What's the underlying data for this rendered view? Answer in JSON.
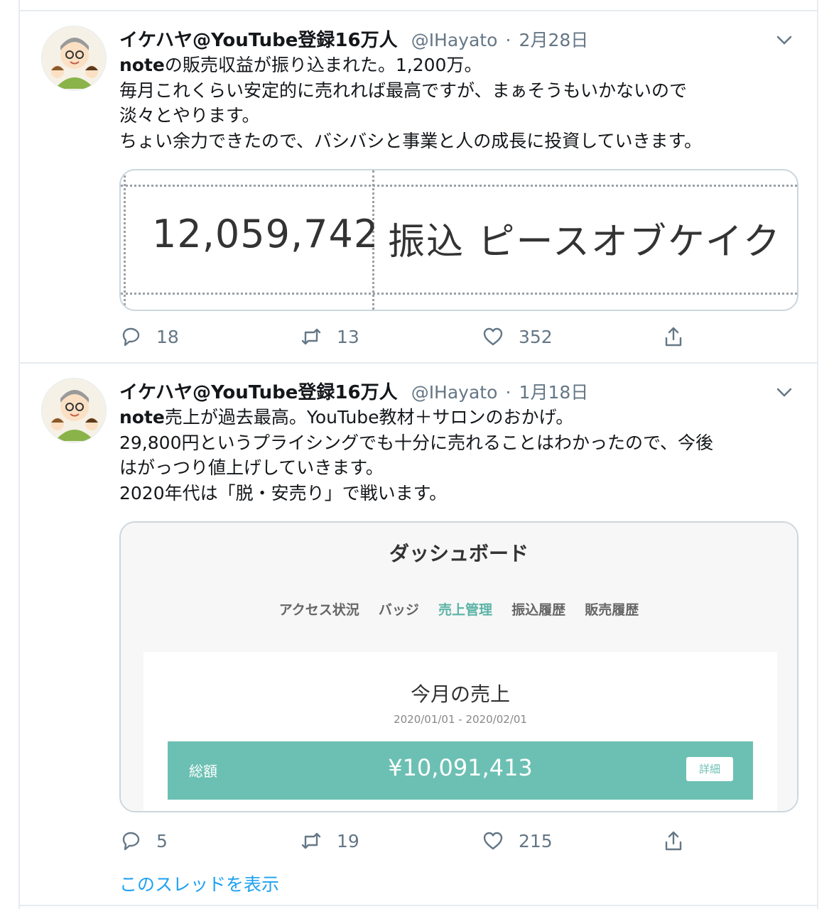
{
  "tweets": [
    {
      "author": "イケハヤ@YouTube登録16万人",
      "handle": "@IHayato",
      "separator": "·",
      "date": "2月28日",
      "lines": [
        {
          "bold": "note",
          "rest": "の販売収益が振り込まれた。1,200万。"
        },
        {
          "bold": "",
          "rest": "毎月これくらい安定的に売れれば最高ですが、まぁそうもいかないので"
        },
        {
          "bold": "",
          "rest": "淡々とやります。"
        },
        {
          "bold": "",
          "rest": "ちょい余力できたので、バシバシと事業と人の成長に投資していきます。"
        }
      ],
      "image": {
        "amount": "12,059,742",
        "text": "振込 ピースオブケイク"
      },
      "replies": "18",
      "retweets": "13",
      "likes": "352"
    },
    {
      "author": "イケハヤ@YouTube登録16万人",
      "handle": "@IHayato",
      "separator": "·",
      "date": "1月18日",
      "lines": [
        {
          "bold": "note",
          "rest": "売上が過去最高。YouTube教材＋サロンのおかげ。"
        },
        {
          "bold": "",
          "rest": "29,800円というプライシングでも十分に売れることはわかったので、今後"
        },
        {
          "bold": "",
          "rest": "はがっつり値上げしていきます。"
        },
        {
          "bold": "",
          "rest": "2020年代は「脱・安売り」で戦います。"
        }
      ],
      "image": {
        "title": "ダッシュボード",
        "tabs": [
          "アクセス状況",
          "バッジ",
          "売上管理",
          "振込履歴",
          "販売履歴"
        ],
        "active_tab": "売上管理",
        "month_label": "今月の売上",
        "range": "2020/01/01 - 2020/02/01",
        "total_label": "総額",
        "total": "¥10,091,413",
        "detail_button": "詳細",
        "accent_color": "#6cc0b3"
      },
      "replies": "5",
      "retweets": "19",
      "likes": "215"
    }
  ],
  "thread_link": "このスレッドを表示",
  "icons": {
    "reply": "reply-icon",
    "retweet": "retweet-icon",
    "like": "heart-icon",
    "share": "share-icon",
    "menu": "chevron-down-icon"
  },
  "colors": {
    "link": "#1da1f2",
    "muted": "#657786",
    "border": "#e6ecf0"
  }
}
